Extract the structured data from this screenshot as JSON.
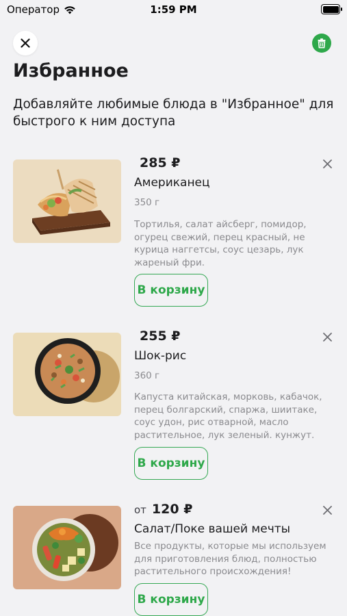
{
  "status_bar": {
    "carrier": "Оператор",
    "time": "1:59 PM"
  },
  "header": {
    "title": "Избранное",
    "subtitle": "Добавляйте любимые блюда в \"Избранное\" для быстрого к ним доступа"
  },
  "icons": {
    "close": "close-icon",
    "trash": "trash-icon",
    "remove": "close-icon",
    "wifi": "wifi-icon",
    "battery": "battery-icon"
  },
  "colors": {
    "accent": "#2ea84a",
    "background": "#f2f2f4",
    "muted_text": "#8a8a8e"
  },
  "items": [
    {
      "price_prefix": "",
      "price": "285 ₽",
      "name": "Американец",
      "weight": "350 г",
      "description": "Тортилья, салат айсберг, помидор, огурец свежий, перец красный, не курица наггетсы, соус цезарь, лук жареный фри.",
      "cart_label": "В корзину"
    },
    {
      "price_prefix": "",
      "price": "255 ₽",
      "name": "Шок-рис",
      "weight": "360 г",
      "description": "Капуста китайская, морковь, кабачок, перец болгарский, спаржа, шиитаке, соус удон, рис отварной, масло растительное, лук зеленый. кунжут.",
      "cart_label": "В корзину"
    },
    {
      "price_prefix": "от",
      "price": "120 ₽",
      "name": "Салат/Поке вашей мечты",
      "weight": "",
      "description": "Все продукты, которые мы используем для приготовления блюд, полностью растительного происхождения!",
      "cart_label": "В корзину"
    }
  ]
}
